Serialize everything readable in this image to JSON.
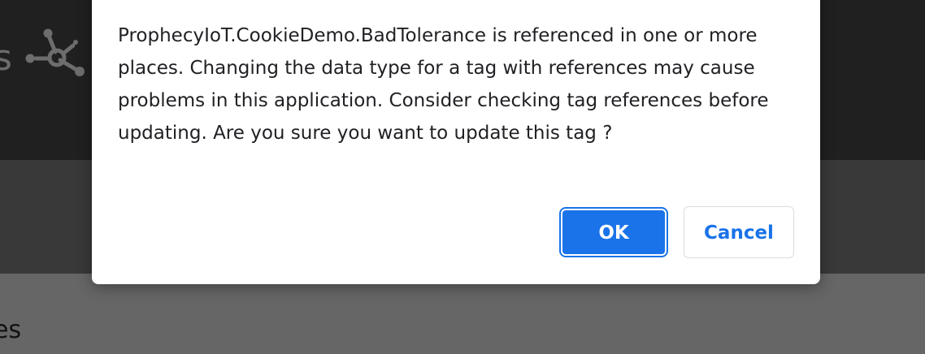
{
  "background": {
    "header_text": "s",
    "logo_icon": "network-hub-icon",
    "section_heading": "es",
    "colors": {
      "header": "#202020",
      "subheader": "#393939",
      "overlay": "#666666"
    }
  },
  "dialog": {
    "message": "ProphecyIoT.CookieDemo.BadTolerance is referenced in one or more places. Changing the data type for a tag with references may cause problems in this application. Consider checking tag references before updating. Are you sure you want to update  this tag ?",
    "ok_label": "OK",
    "cancel_label": "Cancel",
    "colors": {
      "primary": "#1a73e8",
      "text": "#202124",
      "surface": "#ffffff"
    }
  }
}
